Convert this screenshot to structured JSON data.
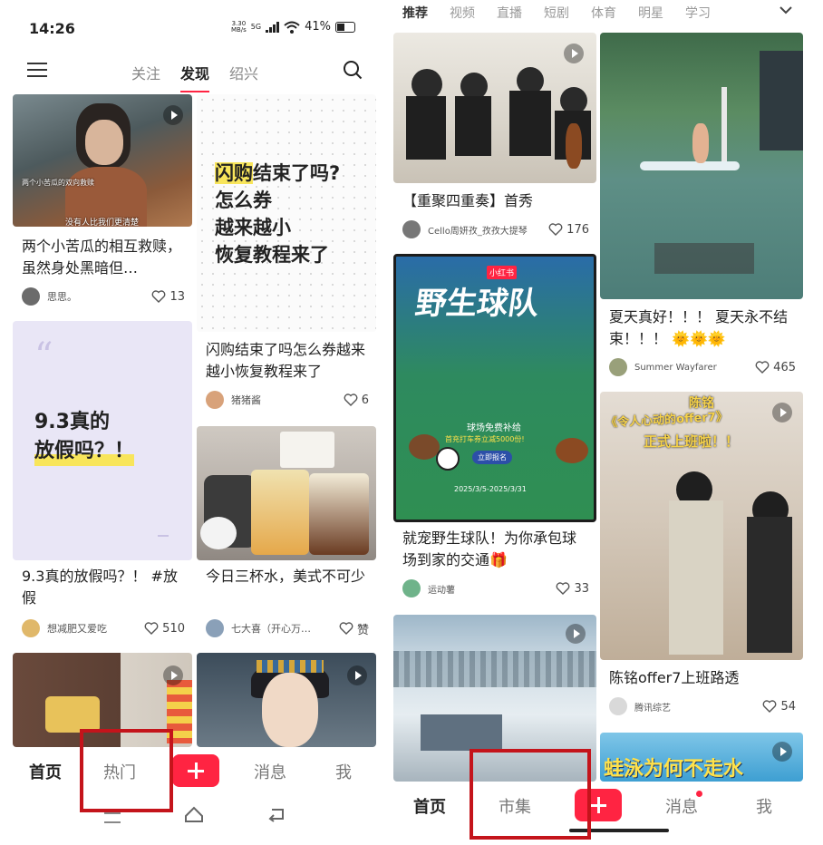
{
  "left": {
    "status": {
      "time": "14:26",
      "speed": "3.30\nMB/s",
      "network": "5G",
      "battery": "41%"
    },
    "tabs": [
      "关注",
      "发现",
      "绍兴"
    ],
    "cards": [
      {
        "title": "两个小苦瓜的相互救赎，虽然身处黑暗但…",
        "author": "思思。",
        "likes": "13",
        "overlay1": "两个小苦瓜的双向救赎",
        "overlay2": "没有人比我们更清楚"
      },
      {
        "title": "闪购结束了吗怎么券越来越小恢复教程来了",
        "author": "猪猪酱",
        "likes": "6",
        "cover_l1": "闪购结束了吗?",
        "cover_l2": "怎么券",
        "cover_l3": "越来越小",
        "cover_l4": "恢复教程来了"
      },
      {
        "title": "9.3真的放假吗？！ #放假",
        "author": "想减肥又爱吃",
        "likes": "510",
        "cover_l1": "9.3真的",
        "cover_l2": "放假吗？！"
      },
      {
        "title": "今日三杯水，美式不可少",
        "author": "七大喜（开心万…",
        "likes": "赞"
      }
    ],
    "bottomnav": {
      "home": "首页",
      "hot": "热门",
      "message": "消息",
      "me": "我"
    }
  },
  "right": {
    "tabs": [
      "推荐",
      "视频",
      "直播",
      "短剧",
      "体育",
      "明星",
      "学习"
    ],
    "cards": [
      {
        "title": "【重聚四重奏】首秀",
        "author": "Cello周妍孜_孜孜大提琴",
        "likes": "176"
      },
      {
        "title": "夏天真好！！！ 夏天永不结束！！！ 🌞🌞🌞",
        "author": "Summer Wayfarer",
        "likes": "465"
      },
      {
        "title": "就宠野生球队！为你承包球场到家的交通🎁",
        "author": "运动薯",
        "likes": "33",
        "poster_title": "野生球队",
        "poster_brand": "小红书",
        "poster_sub": "球场免费补给",
        "poster_sub2": "首充打车券立减5000份!",
        "poster_btn": "立即报名",
        "poster_date": "2025/3/5-2025/3/31"
      },
      {
        "title": "陈铭offer7上班路透",
        "author": "腾讯综艺",
        "likes": "54",
        "banner1": "陈铭",
        "banner2": "《令人心动的offer7》",
        "banner3": "正式上班啦！！"
      },
      {
        "cover_text": "蛙泳为何不走水"
      }
    ],
    "bottomnav": {
      "home": "首页",
      "market": "市集",
      "message": "消息",
      "me": "我"
    }
  }
}
